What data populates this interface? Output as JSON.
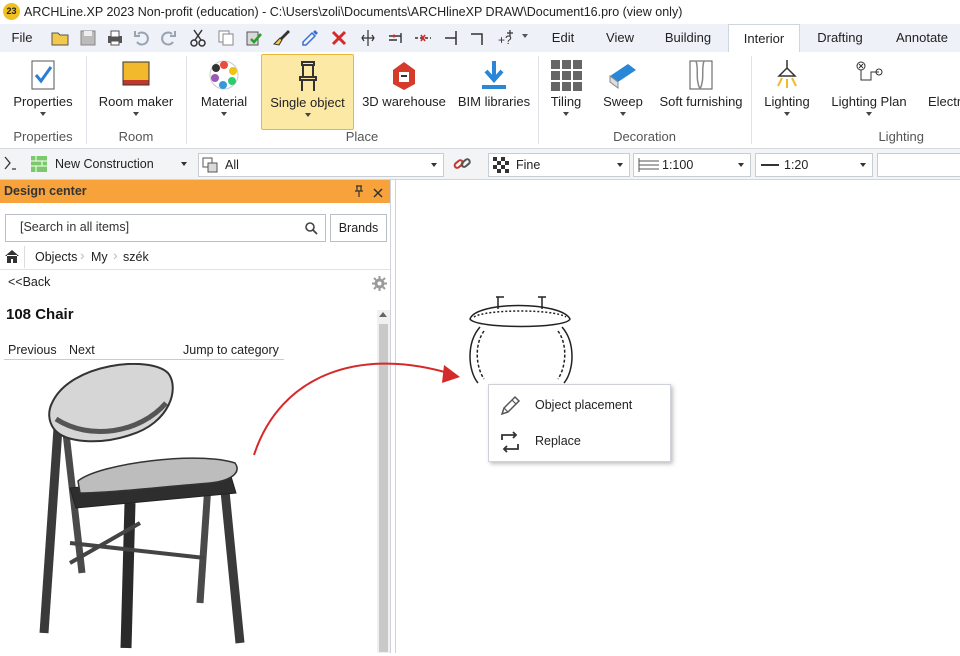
{
  "app": {
    "title": "ARCHLine.XP 2023 Non-profit (education) - C:\\Users\\zoli\\Documents\\ARCHlineXP DRAW\\Document16.pro (view only)",
    "logo_text": "23"
  },
  "ribbon_tabs": {
    "file": "File",
    "edit": "Edit",
    "view": "View",
    "building": "Building",
    "interior": "Interior",
    "drafting": "Drafting",
    "annotate": "Annotate"
  },
  "ribbon": {
    "properties": "Properties",
    "room_maker": "Room maker",
    "material": "Material",
    "single_object": "Single object",
    "warehouse_3d": "3D warehouse",
    "bim_libraries": "BIM libraries",
    "tiling": "Tiling",
    "sweep": "Sweep",
    "soft_furnishing": "Soft furnishing",
    "lighting": "Lighting",
    "lighting_plan": "Lighting Plan",
    "electrical": "Electri",
    "groups": {
      "properties": "Properties",
      "room": "Room",
      "place": "Place",
      "decoration": "Decoration",
      "lighting": "Lighting"
    }
  },
  "layerbar": {
    "layer": "New Construction",
    "scope": "All",
    "detail": "Fine",
    "scale1": "1:100",
    "scale2": "1:20"
  },
  "design_center": {
    "title": "Design center",
    "search_placeholder": "[Search in all items]",
    "brands": "Brands",
    "breadcrumb": [
      "Objects",
      "My",
      "szék"
    ],
    "back": "<<Back",
    "item_title": "108 Chair",
    "previous": "Previous",
    "next": "Next",
    "jump": "Jump to category"
  },
  "context_menu": {
    "items": [
      "Object placement",
      "Replace"
    ]
  },
  "colors": {
    "accent_orange": "#f7a23b",
    "selected_button": "#fde9a6",
    "drag_arrow": "#d42a2a"
  }
}
